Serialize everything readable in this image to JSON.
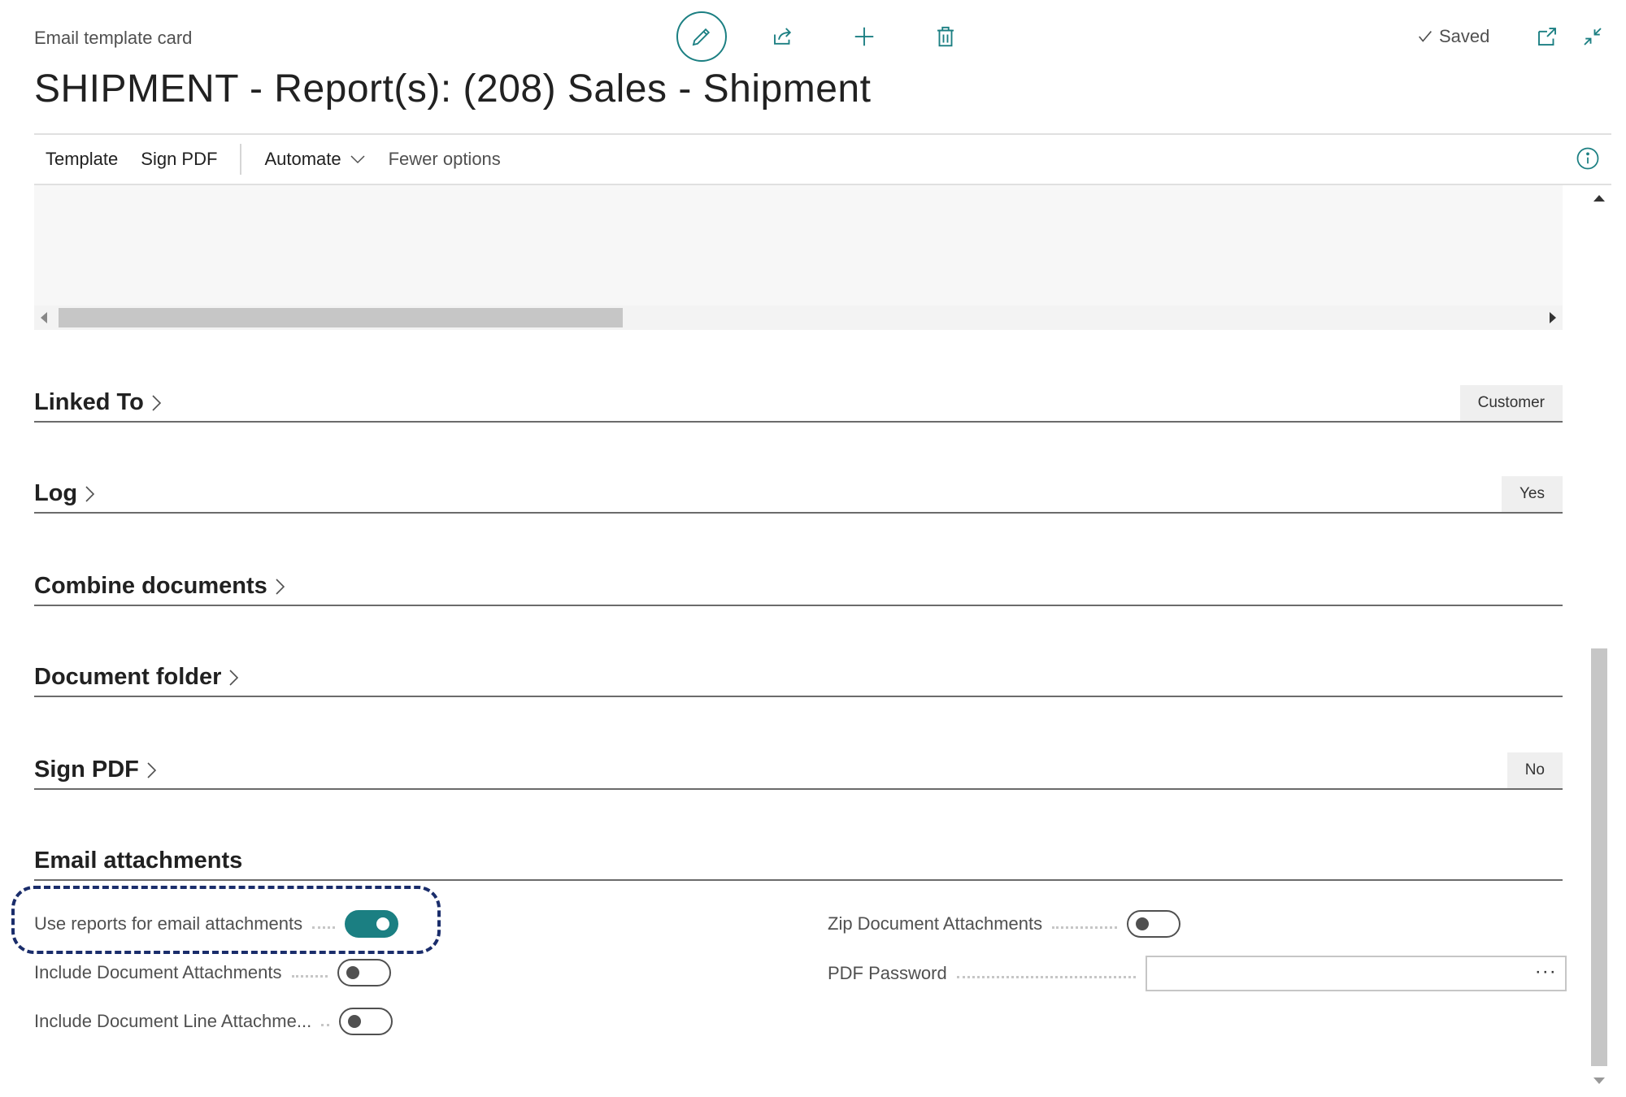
{
  "header": {
    "breadcrumb": "Email template card",
    "title": "SHIPMENT - Report(s): (208) Sales - Shipment",
    "saved_label": "Saved"
  },
  "top_actions": [
    "edit-icon",
    "share-icon",
    "plus-icon",
    "delete-icon"
  ],
  "actionbar": {
    "template": "Template",
    "sign_pdf": "Sign PDF",
    "automate": "Automate",
    "fewer_options": "Fewer options"
  },
  "sections": {
    "linked_to": {
      "title": "Linked To",
      "badge": "Customer"
    },
    "log": {
      "title": "Log",
      "badge": "Yes"
    },
    "combine_documents": {
      "title": "Combine documents"
    },
    "document_folder": {
      "title": "Document folder"
    },
    "sign_pdf": {
      "title": "Sign PDF",
      "badge": "No"
    },
    "email_attachments": {
      "title": "Email attachments"
    }
  },
  "email_attachments": {
    "use_reports": {
      "label": "Use reports for email attachments",
      "value": true
    },
    "include_doc_attachments": {
      "label": "Include Document Attachments",
      "value": false
    },
    "include_doc_line_attachments": {
      "label": "Include Document Line Attachme...",
      "value": false
    },
    "zip_doc_attachments": {
      "label": "Zip Document Attachments",
      "value": false
    },
    "pdf_password": {
      "label": "PDF Password",
      "value": "",
      "ellipsis": "···"
    }
  },
  "colors": {
    "accent": "#1b7f82",
    "highlight_border": "#1a2d6b"
  }
}
